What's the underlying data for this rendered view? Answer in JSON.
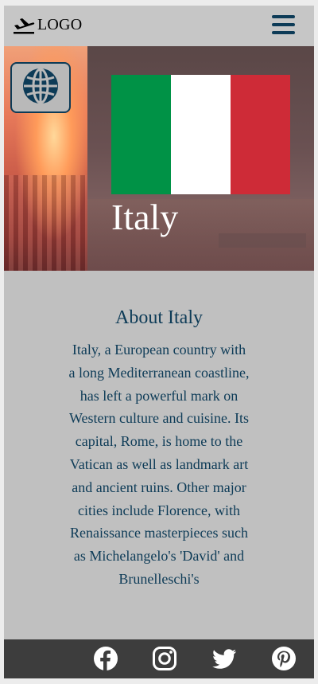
{
  "header": {
    "logo_text": "LOGO",
    "logo_icon": "airplane-departure-icon",
    "menu_icon": "hamburger-menu-icon"
  },
  "hero": {
    "language_icon": "globe-icon",
    "country": "Italy",
    "flag_colors": [
      "#009246",
      "#ffffff",
      "#ce2b37"
    ]
  },
  "about": {
    "title": "About Italy",
    "text": "Italy, a European country with a long Mediterranean coastline, has left a powerful mark on Western culture and cuisine. Its capital, Rome, is home to the Vatican as well as landmark art and ancient ruins. Other major cities include Florence, with Renaissance masterpieces such as Michelangelo's 'David' and Brunelleschi's"
  },
  "footer": {
    "social": [
      "facebook-icon",
      "instagram-icon",
      "twitter-icon",
      "pinterest-icon"
    ]
  },
  "colors": {
    "accent": "#0d3b57",
    "background": "#c0c0c0",
    "footer": "#3d3d3d"
  }
}
